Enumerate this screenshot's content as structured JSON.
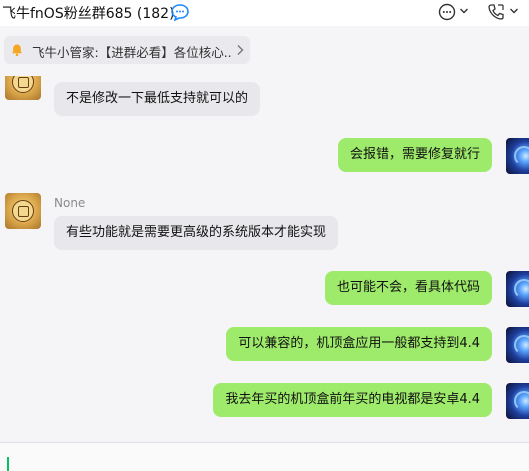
{
  "header": {
    "title": "飞牛fnOS粉丝群685 (182)",
    "icons": [
      "qq-chat-icon",
      "more-icon",
      "chevron-down-icon",
      "phone-icon",
      "chevron-down-icon"
    ]
  },
  "notice": {
    "text": "飞牛小管家:【进群必看】各位核心...",
    "icon": "bell-icon"
  },
  "messages": [
    {
      "side": "in",
      "text": "不是修改一下最低支持就可以的"
    },
    {
      "side": "out",
      "text": "会报错，需要修复就行"
    },
    {
      "side": "in",
      "sender": "None",
      "text": "有些功能就是需要更高级的系统版本才能实现"
    },
    {
      "side": "out",
      "text": "也可能不会，看具体代码"
    },
    {
      "side": "out",
      "text": "可以兼容的，机顶盒应用一般都支持到4.4"
    },
    {
      "side": "out",
      "text": "我去年买的机顶盒前年买的电视都是安卓4.4"
    }
  ],
  "colors": {
    "bubble_out": "#9eea6a",
    "bubble_in": "#e8e8ec",
    "background": "#f5f5f7",
    "accent": "#07c160"
  }
}
